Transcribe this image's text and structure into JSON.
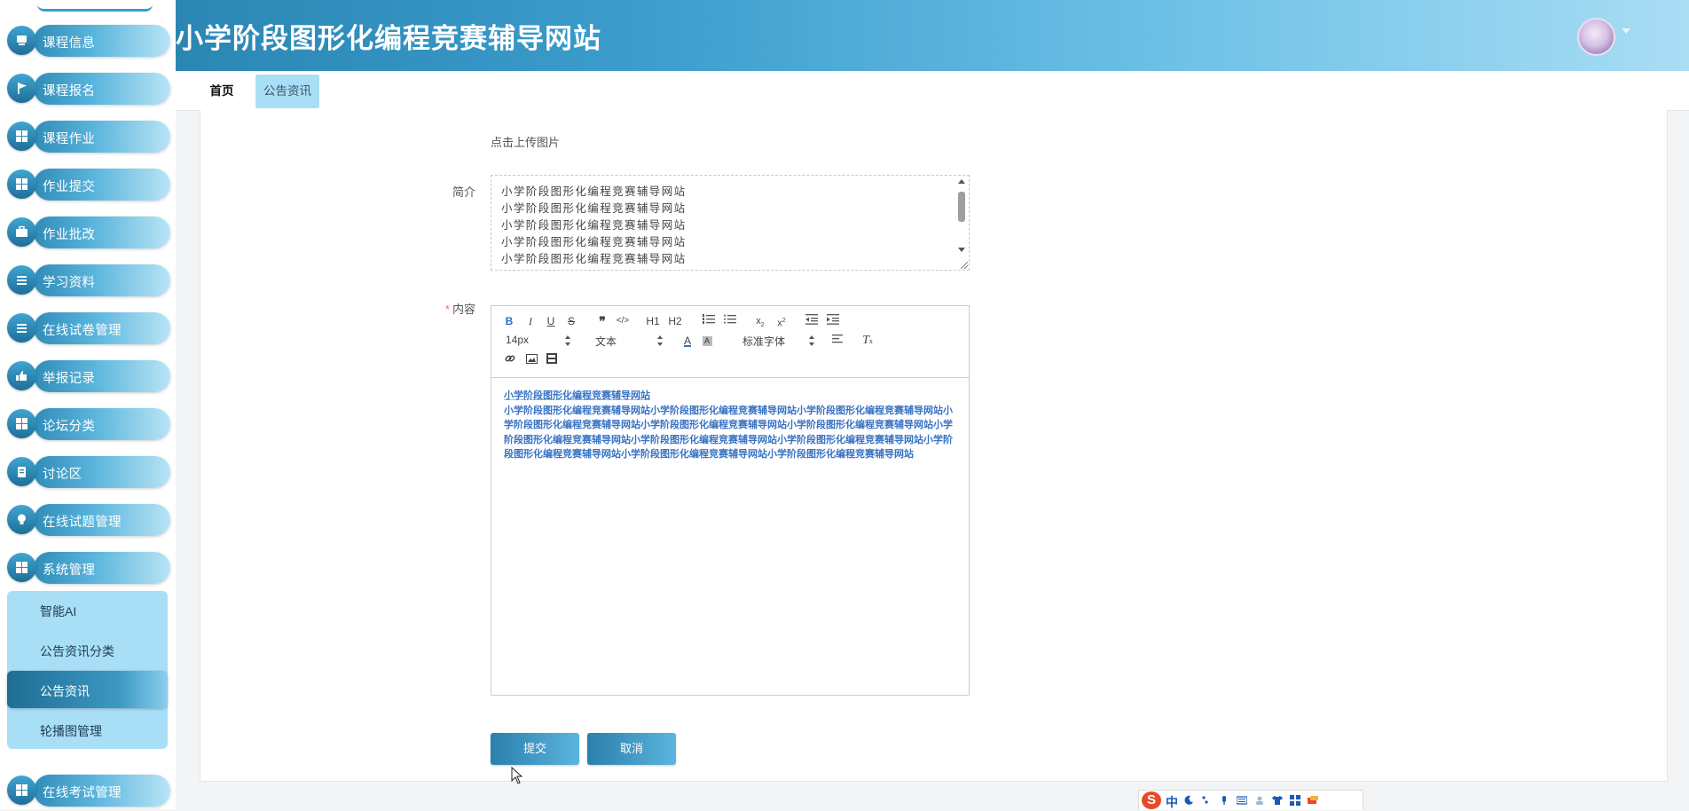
{
  "app": {
    "title": "小学阶段图形化编程竞赛辅导网站"
  },
  "sidebar": {
    "items": [
      {
        "label": "课程信息",
        "icon": "card-icon"
      },
      {
        "label": "课程报名",
        "icon": "flag-icon"
      },
      {
        "label": "课程作业",
        "icon": "grid-icon"
      },
      {
        "label": "作业提交",
        "icon": "grid-icon"
      },
      {
        "label": "作业批改",
        "icon": "briefcase-icon"
      },
      {
        "label": "学习资料",
        "icon": "list-icon"
      },
      {
        "label": "在线试卷管理",
        "icon": "list-icon"
      },
      {
        "label": "举报记录",
        "icon": "thumb-icon"
      },
      {
        "label": "论坛分类",
        "icon": "grid-icon"
      },
      {
        "label": "讨论区",
        "icon": "clipboard-icon"
      },
      {
        "label": "在线试题管理",
        "icon": "bulb-icon"
      },
      {
        "label": "系统管理",
        "icon": "grid-icon"
      },
      {
        "label": "在线考试管理",
        "icon": "grid-icon"
      }
    ],
    "submenu": [
      {
        "label": "智能AI"
      },
      {
        "label": "公告资讯分类"
      },
      {
        "label": "公告资讯",
        "active": true
      },
      {
        "label": "轮播图管理"
      }
    ]
  },
  "tabs": [
    {
      "label": "首页"
    },
    {
      "label": "公告资讯",
      "active": true
    }
  ],
  "form": {
    "upload_hint": "点击上传图片",
    "intro_label": "简介",
    "intro_lines": [
      "小学阶段图形化编程竞赛辅导网站",
      "小学阶段图形化编程竞赛辅导网站",
      "小学阶段图形化编程竞赛辅导网站",
      "小学阶段图形化编程竞赛辅导网站",
      "小学阶段图形化编程竞赛辅导网站"
    ],
    "content_label": "内容",
    "content_required": "*",
    "editor": {
      "font_size": "14px",
      "text_type": "文本",
      "font_family": "标准字体",
      "h1": "H1",
      "h2": "H2",
      "title_line": "小学阶段图形化编程竞赛辅导网站",
      "body": "小学阶段图形化编程竞赛辅导网站小学阶段图形化编程竞赛辅导网站小学阶段图形化编程竞赛辅导网站小学阶段图形化编程竞赛辅导网站小学阶段图形化编程竞赛辅导网站小学阶段图形化编程竞赛辅导网站小学阶段图形化编程竞赛辅导网站小学阶段图形化编程竞赛辅导网站小学阶段图形化编程竞赛辅导网站小学阶段图形化编程竞赛辅导网站小学阶段图形化编程竞赛辅导网站小学阶段图形化编程竞赛辅导网站"
    },
    "submit_label": "提交",
    "cancel_label": "取消"
  },
  "ime": {
    "logo": "S",
    "mode": "中"
  },
  "colors": {
    "accent": "#2b86b3",
    "accent_light": "#a8dff7",
    "required": "#f56c6c",
    "content_text": "#3973c4"
  }
}
